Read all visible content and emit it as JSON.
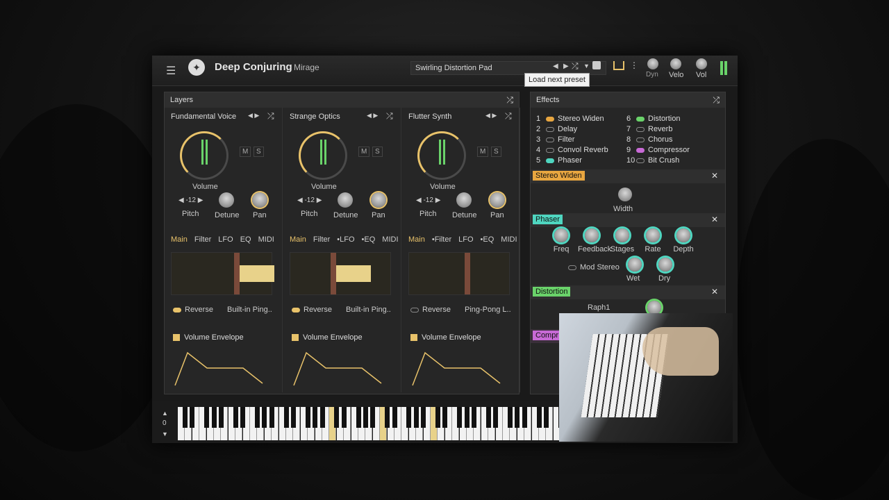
{
  "app": {
    "name": "Deep Conjuring",
    "sub": "Mirage",
    "preset": "Swirling Distortion Pad",
    "tooltip": "Load next preset",
    "dyn": "Dyn",
    "velo": "Velo",
    "vol": "Vol"
  },
  "layers": {
    "title": "Layers",
    "cols": [
      {
        "name": "Fundamental Voice",
        "volume": "Volume",
        "pitch": "-12",
        "pitch_label": "Pitch",
        "detune": "Detune",
        "pan": "Pan",
        "m": "M",
        "s": "S",
        "tabs": [
          "Main",
          "Filter",
          "LFO",
          "EQ",
          "MIDI"
        ],
        "reverse": "Reverse",
        "mode": "Built-in Ping..",
        "env": "Volume Envelope"
      },
      {
        "name": "Strange Optics",
        "volume": "Volume",
        "pitch": "-12",
        "pitch_label": "Pitch",
        "detune": "Detune",
        "pan": "Pan",
        "m": "M",
        "s": "S",
        "tabs": [
          "Main",
          "Filter",
          "•LFO",
          "•EQ",
          "MIDI"
        ],
        "reverse": "Reverse",
        "mode": "Built-in Ping..",
        "env": "Volume Envelope"
      },
      {
        "name": "Flutter Synth",
        "volume": "Volume",
        "pitch": "-12",
        "pitch_label": "Pitch",
        "detune": "Detune",
        "pan": "Pan",
        "m": "M",
        "s": "S",
        "tabs": [
          "Main",
          "•Filter",
          "LFO",
          "•EQ",
          "MIDI"
        ],
        "reverse": "Reverse",
        "mode": "Ping-Pong L..",
        "env": "Volume Envelope"
      }
    ]
  },
  "effects": {
    "title": "Effects",
    "items": [
      {
        "n": "1",
        "name": "Stereo Widen",
        "color": "#e8a640"
      },
      {
        "n": "2",
        "name": "Delay",
        "color": ""
      },
      {
        "n": "3",
        "name": "Filter",
        "color": ""
      },
      {
        "n": "4",
        "name": "Convol Reverb",
        "color": ""
      },
      {
        "n": "5",
        "name": "Phaser",
        "color": "#4fd6c0"
      },
      {
        "n": "6",
        "name": "Distortion",
        "color": "#6ad36a"
      },
      {
        "n": "7",
        "name": "Reverb",
        "color": ""
      },
      {
        "n": "8",
        "name": "Chorus",
        "color": ""
      },
      {
        "n": "9",
        "name": "Compressor",
        "color": "#c86ad6"
      },
      {
        "n": "10",
        "name": "Bit Crush",
        "color": ""
      }
    ],
    "stereo": {
      "title": "Stereo Widen",
      "width": "Width"
    },
    "phaser": {
      "title": "Phaser",
      "freq": "Freq",
      "feedback": "Feedback",
      "stages": "Stages",
      "rate": "Rate",
      "depth": "Depth",
      "mod": "Mod Stereo",
      "wet": "Wet",
      "dry": "Dry"
    },
    "distortion": {
      "title": "Distortion",
      "type": "Raph1"
    },
    "comp": {
      "title": "Compr"
    }
  },
  "keyboard": {
    "octave": "0"
  }
}
